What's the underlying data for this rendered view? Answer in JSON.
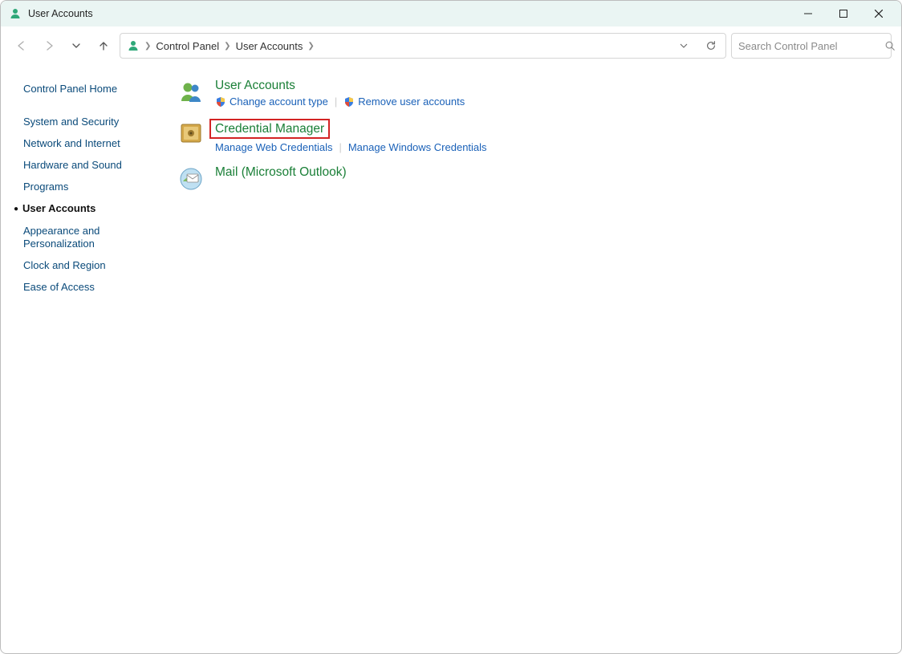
{
  "window": {
    "title": "User Accounts"
  },
  "breadcrumb": {
    "parts": [
      "Control Panel",
      "User Accounts"
    ]
  },
  "search": {
    "placeholder": "Search Control Panel"
  },
  "sidebar": {
    "items": [
      {
        "label": "Control Panel Home",
        "active": false
      },
      {
        "label": "System and Security",
        "active": false
      },
      {
        "label": "Network and Internet",
        "active": false
      },
      {
        "label": "Hardware and Sound",
        "active": false
      },
      {
        "label": "Programs",
        "active": false
      },
      {
        "label": "User Accounts",
        "active": true
      },
      {
        "label": "Appearance and Personalization",
        "active": false
      },
      {
        "label": "Clock and Region",
        "active": false
      },
      {
        "label": "Ease of Access",
        "active": false
      }
    ]
  },
  "main": {
    "categories": [
      {
        "title": "User Accounts",
        "highlighted": false,
        "tasks": [
          {
            "label": "Change account type",
            "shield": true
          },
          {
            "label": "Remove user accounts",
            "shield": true
          }
        ]
      },
      {
        "title": "Credential Manager",
        "highlighted": true,
        "tasks": [
          {
            "label": "Manage Web Credentials",
            "shield": false
          },
          {
            "label": "Manage Windows Credentials",
            "shield": false
          }
        ]
      },
      {
        "title": "Mail (Microsoft Outlook)",
        "highlighted": false,
        "tasks": []
      }
    ]
  }
}
